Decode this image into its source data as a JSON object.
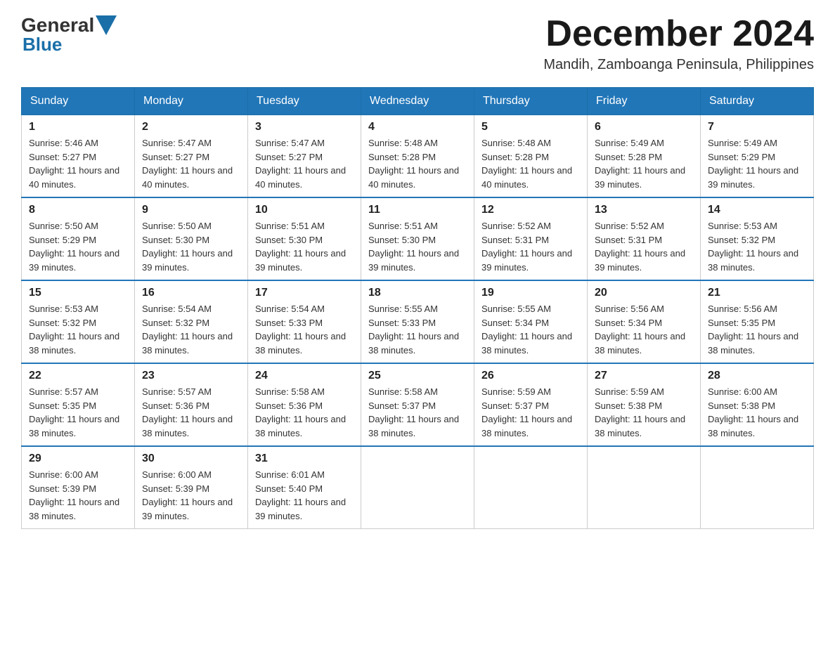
{
  "header": {
    "logo_general": "General",
    "logo_blue": "Blue",
    "month_title": "December 2024",
    "location": "Mandih, Zamboanga Peninsula, Philippines"
  },
  "days_of_week": [
    "Sunday",
    "Monday",
    "Tuesday",
    "Wednesday",
    "Thursday",
    "Friday",
    "Saturday"
  ],
  "weeks": [
    [
      {
        "day": "1",
        "sunrise": "5:46 AM",
        "sunset": "5:27 PM",
        "daylight": "11 hours and 40 minutes."
      },
      {
        "day": "2",
        "sunrise": "5:47 AM",
        "sunset": "5:27 PM",
        "daylight": "11 hours and 40 minutes."
      },
      {
        "day": "3",
        "sunrise": "5:47 AM",
        "sunset": "5:27 PM",
        "daylight": "11 hours and 40 minutes."
      },
      {
        "day": "4",
        "sunrise": "5:48 AM",
        "sunset": "5:28 PM",
        "daylight": "11 hours and 40 minutes."
      },
      {
        "day": "5",
        "sunrise": "5:48 AM",
        "sunset": "5:28 PM",
        "daylight": "11 hours and 40 minutes."
      },
      {
        "day": "6",
        "sunrise": "5:49 AM",
        "sunset": "5:28 PM",
        "daylight": "11 hours and 39 minutes."
      },
      {
        "day": "7",
        "sunrise": "5:49 AM",
        "sunset": "5:29 PM",
        "daylight": "11 hours and 39 minutes."
      }
    ],
    [
      {
        "day": "8",
        "sunrise": "5:50 AM",
        "sunset": "5:29 PM",
        "daylight": "11 hours and 39 minutes."
      },
      {
        "day": "9",
        "sunrise": "5:50 AM",
        "sunset": "5:30 PM",
        "daylight": "11 hours and 39 minutes."
      },
      {
        "day": "10",
        "sunrise": "5:51 AM",
        "sunset": "5:30 PM",
        "daylight": "11 hours and 39 minutes."
      },
      {
        "day": "11",
        "sunrise": "5:51 AM",
        "sunset": "5:30 PM",
        "daylight": "11 hours and 39 minutes."
      },
      {
        "day": "12",
        "sunrise": "5:52 AM",
        "sunset": "5:31 PM",
        "daylight": "11 hours and 39 minutes."
      },
      {
        "day": "13",
        "sunrise": "5:52 AM",
        "sunset": "5:31 PM",
        "daylight": "11 hours and 39 minutes."
      },
      {
        "day": "14",
        "sunrise": "5:53 AM",
        "sunset": "5:32 PM",
        "daylight": "11 hours and 38 minutes."
      }
    ],
    [
      {
        "day": "15",
        "sunrise": "5:53 AM",
        "sunset": "5:32 PM",
        "daylight": "11 hours and 38 minutes."
      },
      {
        "day": "16",
        "sunrise": "5:54 AM",
        "sunset": "5:32 PM",
        "daylight": "11 hours and 38 minutes."
      },
      {
        "day": "17",
        "sunrise": "5:54 AM",
        "sunset": "5:33 PM",
        "daylight": "11 hours and 38 minutes."
      },
      {
        "day": "18",
        "sunrise": "5:55 AM",
        "sunset": "5:33 PM",
        "daylight": "11 hours and 38 minutes."
      },
      {
        "day": "19",
        "sunrise": "5:55 AM",
        "sunset": "5:34 PM",
        "daylight": "11 hours and 38 minutes."
      },
      {
        "day": "20",
        "sunrise": "5:56 AM",
        "sunset": "5:34 PM",
        "daylight": "11 hours and 38 minutes."
      },
      {
        "day": "21",
        "sunrise": "5:56 AM",
        "sunset": "5:35 PM",
        "daylight": "11 hours and 38 minutes."
      }
    ],
    [
      {
        "day": "22",
        "sunrise": "5:57 AM",
        "sunset": "5:35 PM",
        "daylight": "11 hours and 38 minutes."
      },
      {
        "day": "23",
        "sunrise": "5:57 AM",
        "sunset": "5:36 PM",
        "daylight": "11 hours and 38 minutes."
      },
      {
        "day": "24",
        "sunrise": "5:58 AM",
        "sunset": "5:36 PM",
        "daylight": "11 hours and 38 minutes."
      },
      {
        "day": "25",
        "sunrise": "5:58 AM",
        "sunset": "5:37 PM",
        "daylight": "11 hours and 38 minutes."
      },
      {
        "day": "26",
        "sunrise": "5:59 AM",
        "sunset": "5:37 PM",
        "daylight": "11 hours and 38 minutes."
      },
      {
        "day": "27",
        "sunrise": "5:59 AM",
        "sunset": "5:38 PM",
        "daylight": "11 hours and 38 minutes."
      },
      {
        "day": "28",
        "sunrise": "6:00 AM",
        "sunset": "5:38 PM",
        "daylight": "11 hours and 38 minutes."
      }
    ],
    [
      {
        "day": "29",
        "sunrise": "6:00 AM",
        "sunset": "5:39 PM",
        "daylight": "11 hours and 38 minutes."
      },
      {
        "day": "30",
        "sunrise": "6:00 AM",
        "sunset": "5:39 PM",
        "daylight": "11 hours and 39 minutes."
      },
      {
        "day": "31",
        "sunrise": "6:01 AM",
        "sunset": "5:40 PM",
        "daylight": "11 hours and 39 minutes."
      },
      null,
      null,
      null,
      null
    ]
  ]
}
